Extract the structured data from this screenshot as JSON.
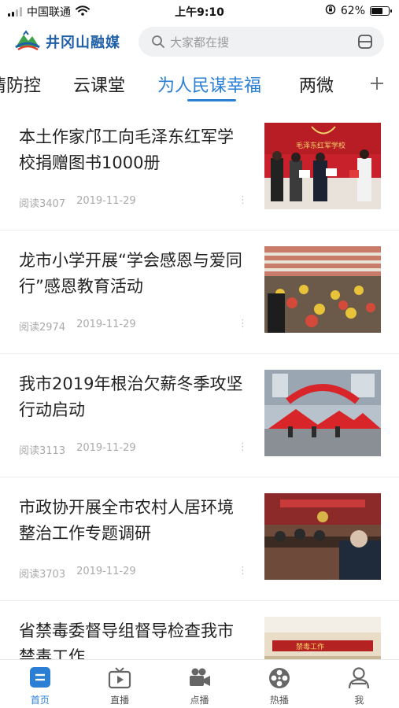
{
  "status_bar": {
    "carrier": "中国联通",
    "time": "上午9:10",
    "battery": "62%",
    "icons": [
      "signal-icon",
      "wifi-icon",
      "orientation-lock-icon",
      "battery-icon"
    ]
  },
  "header": {
    "logo_text": "井冈山融媒",
    "search_placeholder": "大家都在搜",
    "icons": [
      "logo-icon",
      "search-icon",
      "scan-icon"
    ]
  },
  "tabs": {
    "items": [
      {
        "label": "情防控"
      },
      {
        "label": "云课堂"
      },
      {
        "label": "为人民谋幸福",
        "active": true
      },
      {
        "label": "两微"
      }
    ],
    "add_icon": "plus-icon"
  },
  "news": [
    {
      "title": "本土作家邝工向毛泽东红军学校捐赠图书1000册",
      "reads": "阅读3407",
      "date": "2019-11-29",
      "more": "⋮",
      "thumbnail": "donation-ceremony-photo"
    },
    {
      "title": "龙市小学开展“学会感恩与爱同行”感恩教育活动",
      "reads": "阅读2974",
      "date": "2019-11-29",
      "more": "⋮",
      "thumbnail": "school-playground-crowd-photo"
    },
    {
      "title": "我市2019年根治欠薪冬季攻坚行动启动",
      "reads": "阅读3113",
      "date": "2019-11-29",
      "more": "⋮",
      "thumbnail": "red-tent-event-photo"
    },
    {
      "title": "市政协开展全市农村人居环境整治工作专题调研",
      "reads": "阅读3703",
      "date": "2019-11-29",
      "more": "⋮",
      "thumbnail": "meeting-room-photo"
    },
    {
      "title": "省禁毒委督导组督导检查我市禁毒工作",
      "reads": "",
      "date": "",
      "more": "",
      "thumbnail": "banner-hall-photo"
    }
  ],
  "bottom_nav": [
    {
      "label": "首页",
      "icon": "home-icon",
      "active": true
    },
    {
      "label": "直播",
      "icon": "tv-icon"
    },
    {
      "label": "点播",
      "icon": "video-camera-icon"
    },
    {
      "label": "热播",
      "icon": "film-reel-icon"
    },
    {
      "label": "我",
      "icon": "user-icon"
    }
  ],
  "colors": {
    "accent": "#2a7fd4",
    "logo": "#1f5fa8"
  }
}
